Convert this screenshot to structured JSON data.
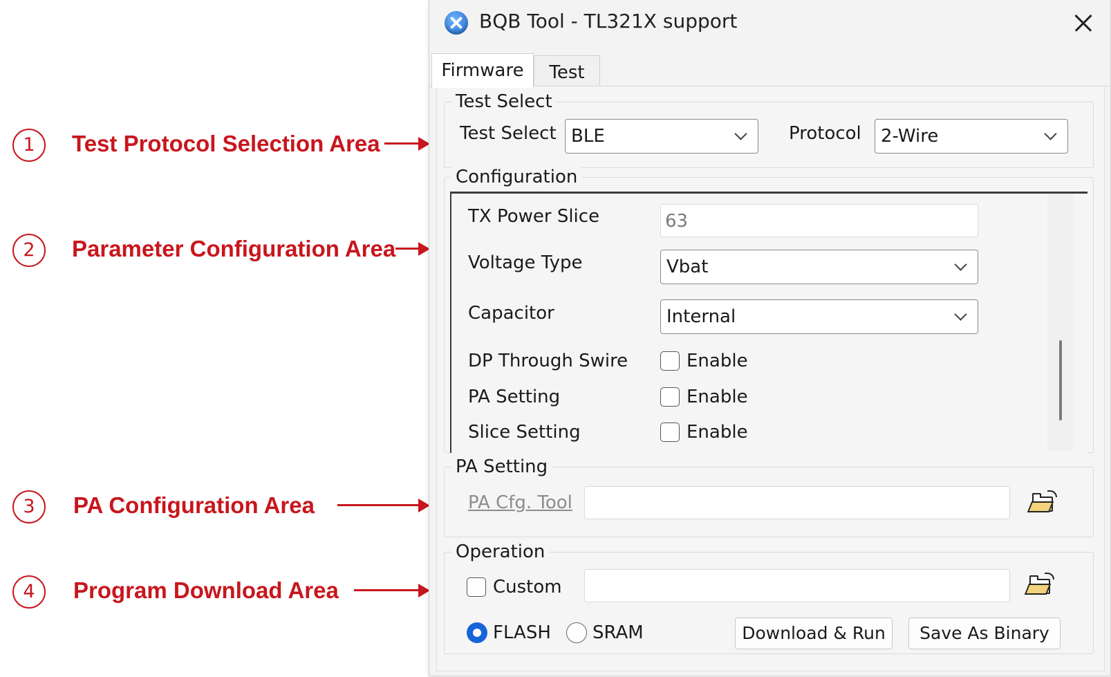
{
  "annotations": [
    {
      "number": "1",
      "label": "Test Protocol Selection Area"
    },
    {
      "number": "2",
      "label": "Parameter Configuration Area"
    },
    {
      "number": "3",
      "label": "PA Configuration Area"
    },
    {
      "number": "4",
      "label": "Program Download Area"
    }
  ],
  "window": {
    "title": "BQB Tool - TL321X support"
  },
  "tabs": [
    {
      "label": "Firmware",
      "active": true
    },
    {
      "label": "Test",
      "active": false
    }
  ],
  "test_select": {
    "group_title": "Test Select",
    "test_label": "Test Select",
    "test_value": "BLE",
    "protocol_label": "Protocol",
    "protocol_value": "2-Wire"
  },
  "configuration": {
    "group_title": "Configuration",
    "tx_power_label": "TX Power Slice",
    "tx_power_value": "63",
    "voltage_label": "Voltage Type",
    "voltage_value": "Vbat",
    "capacitor_label": "Capacitor",
    "capacitor_value": "Internal",
    "dp_label": "DP Through Swire",
    "dp_enable": "Enable",
    "pa_label": "PA Setting",
    "pa_enable": "Enable",
    "slice_label": "Slice Setting",
    "slice_enable": "Enable"
  },
  "pa_setting": {
    "group_title": "PA Setting",
    "tool_link": "PA Cfg. Tool",
    "path_value": ""
  },
  "operation": {
    "group_title": "Operation",
    "custom_label": "Custom",
    "path_value": "",
    "flash_label": "FLASH",
    "sram_label": "SRAM",
    "download_button": "Download & Run",
    "save_button": "Save As Binary"
  },
  "colors": {
    "annotation": "#c8161d",
    "accent": "#1565d8"
  }
}
